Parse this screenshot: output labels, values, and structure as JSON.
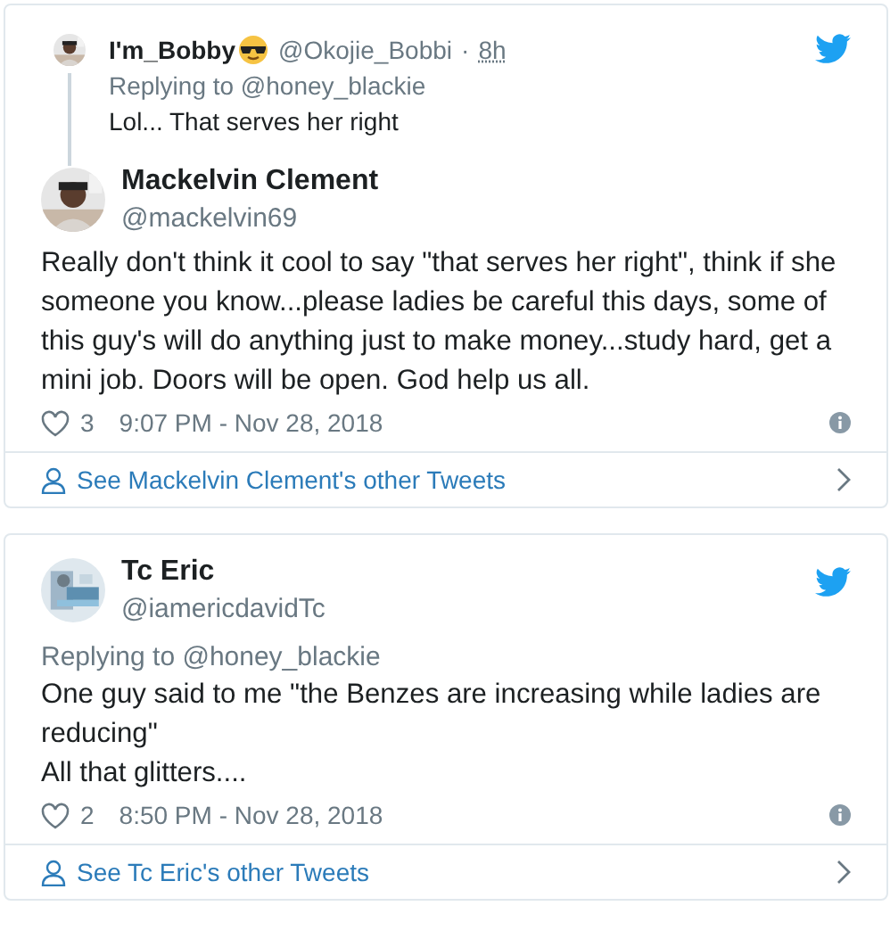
{
  "tweets": [
    {
      "parent": {
        "name": "I'm_Bobby",
        "handle": "@Okojie_Bobbi",
        "separator": "·",
        "time": "8h",
        "replying_to": "Replying to @honey_blackie",
        "text": "Lol... That serves her right"
      },
      "name": "Mackelvin Clement",
      "handle": "@mackelvin69",
      "text": "Really don't think it cool to say \"that serves her right\", think if she someone you know...please ladies be careful this days, some of this guy's will do anything just to make money...study hard, get a mini job. Doors will be open. God help us all.",
      "likes": "3",
      "time": "9:07 PM - Nov 28, 2018",
      "see_more": "See Mackelvin Clement's other Tweets"
    },
    {
      "name": "Tc Eric",
      "handle": "@iamericdavidTc",
      "replying_to": "Replying to @honey_blackie",
      "text": "One guy said to me \"the Benzes are increasing while ladies are reducing\"\nAll that glitters....",
      "likes": "2",
      "time": "8:50 PM - Nov 28, 2018",
      "see_more": "See Tc Eric's other Tweets"
    }
  ]
}
